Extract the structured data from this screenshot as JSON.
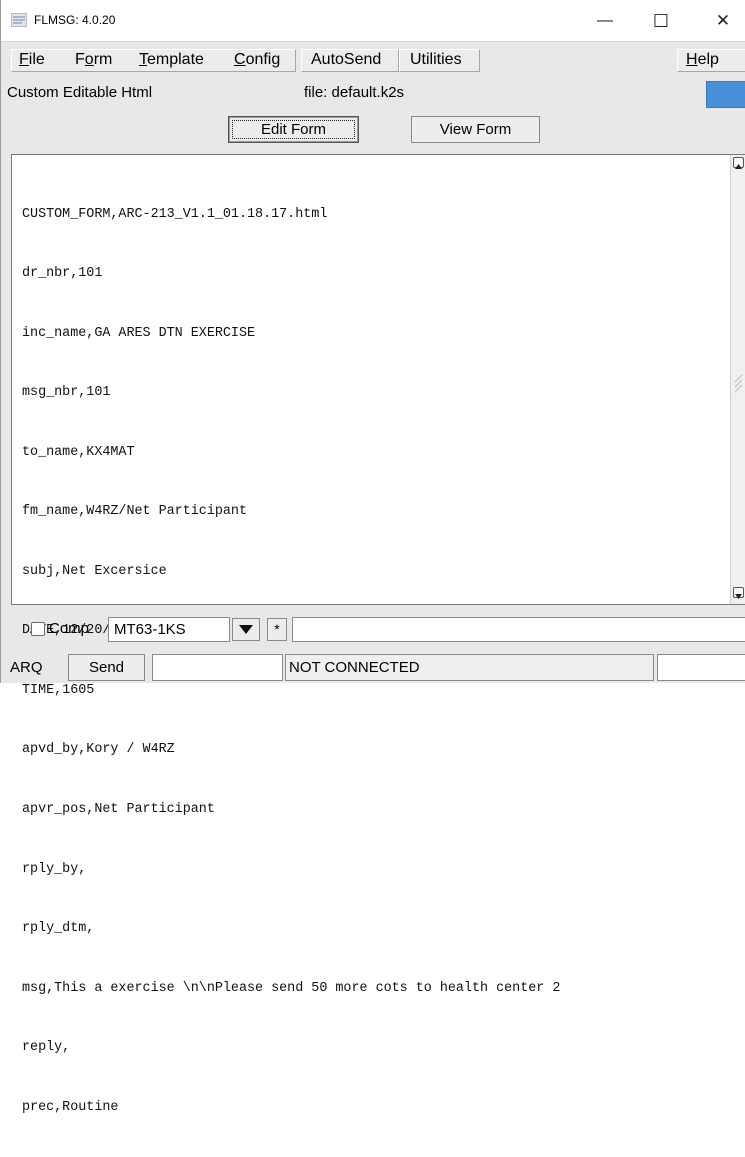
{
  "window": {
    "title": "FLMSG: 4.0.20",
    "minimize_glyph": "—",
    "maximize_glyph": "☐",
    "close_glyph": "✕"
  },
  "menu": {
    "file": "File",
    "form": "Form",
    "template": "Template",
    "config": "Config",
    "autosend": "AutoSend",
    "utilities": "Utilities",
    "help": "Help"
  },
  "info": {
    "form_type": "Custom Editable Html",
    "file_label": "file: default.k2s",
    "accent_color": "#4a90d9"
  },
  "buttons": {
    "edit_form": "Edit Form",
    "view_form": "View Form"
  },
  "editor": {
    "lines": [
      "CUSTOM_FORM,ARC-213_V1.1_01.18.17.html",
      "dr_nbr,101",
      "inc_name,GA ARES DTN EXERCISE",
      "msg_nbr,101",
      "to_name,KX4MAT",
      "fm_name,W4RZ/Net Participant",
      "subj,Net Excersice",
      "DATE,12/20/2023",
      "TIME,1605",
      "apvd_by,Kory / W4RZ",
      "apvr_pos,Net Participant",
      "rply_by,",
      "rply_dtm,",
      "msg,This a exercise \\n\\nPlease send 50 more cots to health center 2",
      "reply,",
      "prec,Routine"
    ]
  },
  "compress_row": {
    "comp_label": "Comp",
    "comp_checked": false,
    "encoder_value": "MT63-1KS",
    "star_label": "*",
    "extra_value": ""
  },
  "status_row": {
    "arq_label": "ARQ",
    "send_label": "Send",
    "send_field_value": "",
    "status_text": "NOT CONNECTED",
    "right_field_value": ""
  },
  "icons": {
    "app": "flmsg-app-icon",
    "dropdown": "triangle-down-icon",
    "scroll_up": "triangle-up-icon",
    "scroll_down": "triangle-down-icon"
  }
}
